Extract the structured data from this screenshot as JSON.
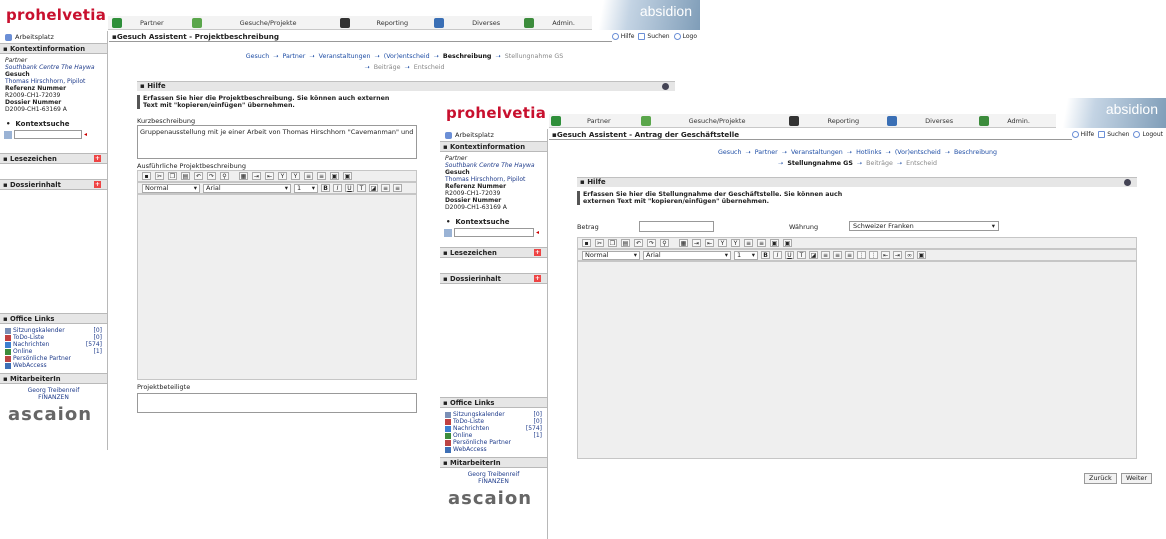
{
  "brand": {
    "prefix": "pro",
    "logo": "prohelvetia",
    "vendor": "absidion",
    "footer_logo": "ascaion"
  },
  "menu": {
    "partner": "Partner",
    "gesuche": "Gesuche/Projekte",
    "reporting": "Reporting",
    "diverses": "Diverses",
    "admin": "Admin."
  },
  "toolbar": {
    "hilfe": "Hilfe",
    "suchen": "Suchen",
    "logout": "Logout",
    "logout_cut": "Logo"
  },
  "sidebar": {
    "arbeitsplatz": "Arbeitsplatz",
    "kontext_title": "Kontextinformation",
    "partner_label": "Partner",
    "partner_value": "Southbank Centre The Haywa",
    "gesuch_label": "Gesuch",
    "gesuch_value": "Thomas Hirschhorn, Pipilot",
    "ref_label": "Referenz Nummer",
    "ref_value": "R2009-CH1-72039",
    "dossier_label": "Dossier Nummer",
    "dossier_value": "D2009-CH1-63169 A",
    "kontextsuche": "Kontextsuche",
    "lesezeichen": "Lesezeichen",
    "dossierinhalt": "Dossierinhalt",
    "office_title": "Office Links",
    "office_links": [
      {
        "label": "Sitzungskalender",
        "count": "[0]"
      },
      {
        "label": "ToDo-Liste",
        "count": "[0]"
      },
      {
        "label": "Nachrichten",
        "count": "[574]"
      },
      {
        "label": "Online",
        "count": "[1]"
      },
      {
        "label": "Persönliche Partner",
        "count": ""
      },
      {
        "label": "WebAccess",
        "count": ""
      }
    ],
    "mitarbeiter_title": "MitarbeiterIn",
    "mitarbeiter_name": "Georg Treibenreif",
    "mitarbeiter_dept": "FINANZEN",
    "plus": "+"
  },
  "w1": {
    "title": "Gesuch Assistent - Projektbeschreibung",
    "steps_line1": [
      {
        "label": "Gesuch",
        "state": "done"
      },
      {
        "label": "Partner",
        "state": "done"
      },
      {
        "label": "Veranstaltungen",
        "state": "done"
      },
      {
        "label": "(Vor)entscheid",
        "state": "done"
      },
      {
        "label": "Beschreibung",
        "state": "cur"
      },
      {
        "label": "Stellungnahme GS",
        "state": "fut"
      }
    ],
    "steps_line2": [
      {
        "label": "Beiträge",
        "state": "fut"
      },
      {
        "label": "Entscheid",
        "state": "fut"
      }
    ],
    "hilfe": "Hilfe",
    "hilfe_text": "Erfassen Sie hier die Projektbeschreibung. Sie können auch externen Text mit \"kopieren/einfügen\" übernehmen.",
    "kurz_label": "Kurzbeschreibung",
    "kurz_value": "Gruppenausstellung mit je einer Arbeit von Thomas Hirschhorn \"Cavemanman\" und Pip",
    "ausf_label": "Ausführliche Projektbeschreibung",
    "style": "Normal",
    "font": "Arial",
    "size": "1",
    "beteiligte_label": "Projektbeteiligte"
  },
  "w2": {
    "title": "Gesuch Assistent - Antrag der Geschäftstelle",
    "steps_line1": [
      {
        "label": "Gesuch",
        "state": "done"
      },
      {
        "label": "Partner",
        "state": "done"
      },
      {
        "label": "Veranstaltungen",
        "state": "done"
      },
      {
        "label": "Hotlinks",
        "state": "done"
      },
      {
        "label": "(Vor)entscheid",
        "state": "done"
      },
      {
        "label": "Beschreibung",
        "state": "done"
      }
    ],
    "steps_line2": [
      {
        "label": "Stellungnahme GS",
        "state": "cur"
      },
      {
        "label": "Beiträge",
        "state": "fut"
      },
      {
        "label": "Entscheid",
        "state": "fut"
      }
    ],
    "hilfe": "Hilfe",
    "hilfe_text": "Erfassen Sie hier die Stellungnahme der Geschäftstelle. Sie können auch externen Text mit \"kopieren/einfügen\" übernehmen.",
    "betrag_label": "Betrag",
    "waehrung_label": "Währung",
    "waehrung_value": "Schweizer Franken",
    "style": "Normal",
    "font": "Arial",
    "size": "1",
    "zurueck": "Zurück",
    "weiter": "Weiter"
  },
  "icons": [
    "save-icon",
    "cut-icon",
    "copy-icon",
    "paste-icon",
    "undo-icon",
    "redo-icon",
    "find-icon",
    "table-icon",
    "bold-icon",
    "italic-icon",
    "underline-icon",
    "link-icon"
  ]
}
